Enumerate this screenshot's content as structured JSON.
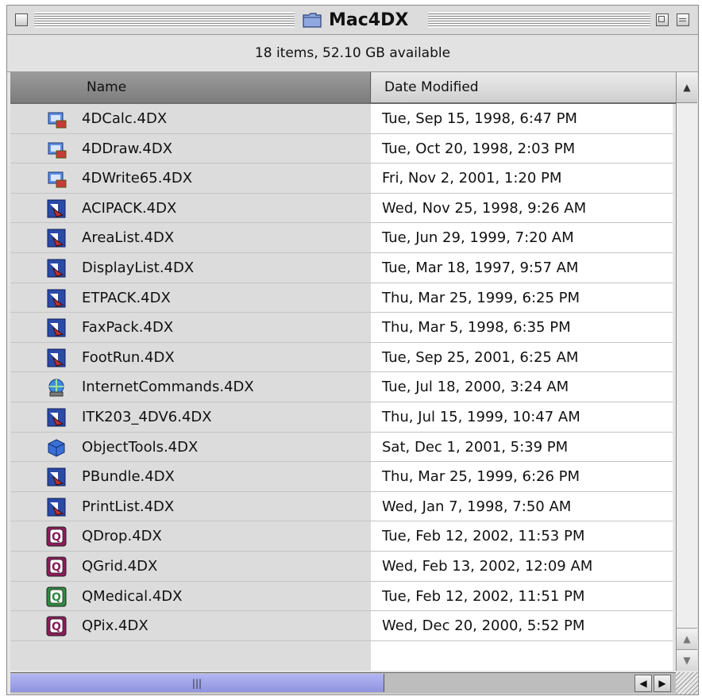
{
  "window": {
    "title": "Mac4DX",
    "status": "18 items, 52.10 GB available"
  },
  "columns": {
    "name": "Name",
    "date": "Date Modified"
  },
  "icons": {
    "folder": "folder-icon",
    "plugin": "plugin-icon",
    "q_purple": "q-icon",
    "q_green": "q-icon"
  },
  "colors": {
    "q_purple": "#8b1c5a",
    "q_green": "#2e8b3f",
    "hscroll_thumb": "#9a9ee6"
  },
  "files": [
    {
      "name": "4DCalc.4DX",
      "date": "Tue, Sep 15, 1998, 6:47 PM",
      "icon": "4d-calc-icon"
    },
    {
      "name": "4DDraw.4DX",
      "date": "Tue, Oct 20, 1998, 2:03 PM",
      "icon": "4d-draw-icon"
    },
    {
      "name": "4DWrite65.4DX",
      "date": "Fri, Nov 2, 2001, 1:20 PM",
      "icon": "4d-write-icon"
    },
    {
      "name": "ACIPACK.4DX",
      "date": "Wed, Nov 25, 1998, 9:26 AM",
      "icon": "plugin-icon"
    },
    {
      "name": "AreaList.4DX",
      "date": "Tue, Jun 29, 1999, 7:20 AM",
      "icon": "plugin-icon"
    },
    {
      "name": "DisplayList.4DX",
      "date": "Tue, Mar 18, 1997, 9:57 AM",
      "icon": "plugin-icon"
    },
    {
      "name": "ETPACK.4DX",
      "date": "Thu, Mar 25, 1999, 6:25 PM",
      "icon": "plugin-icon"
    },
    {
      "name": "FaxPack.4DX",
      "date": "Thu, Mar 5, 1998, 6:35 PM",
      "icon": "plugin-icon"
    },
    {
      "name": "FootRun.4DX",
      "date": "Tue, Sep 25, 2001, 6:25 AM",
      "icon": "plugin-icon"
    },
    {
      "name": "InternetCommands.4DX",
      "date": "Tue, Jul 18, 2000, 3:24 AM",
      "icon": "internet-icon"
    },
    {
      "name": "ITK203_4DV6.4DX",
      "date": "Thu, Jul 15, 1999, 10:47 AM",
      "icon": "plugin-icon"
    },
    {
      "name": "ObjectTools.4DX",
      "date": "Sat, Dec 1, 2001, 5:39 PM",
      "icon": "cube-icon"
    },
    {
      "name": "PBundle.4DX",
      "date": "Thu, Mar 25, 1999, 6:26 PM",
      "icon": "plugin-icon"
    },
    {
      "name": "PrintList.4DX",
      "date": "Wed, Jan 7, 1998, 7:50 AM",
      "icon": "plugin-icon"
    },
    {
      "name": "QDrop.4DX",
      "date": "Tue, Feb 12, 2002, 11:53 PM",
      "icon": "q-icon"
    },
    {
      "name": "QGrid.4DX",
      "date": "Wed, Feb 13, 2002, 12:09 AM",
      "icon": "q-icon"
    },
    {
      "name": "QMedical.4DX",
      "date": "Tue, Feb 12, 2002, 11:51 PM",
      "icon": "q-icon"
    },
    {
      "name": "QPix.4DX",
      "date": "Wed, Dec 20, 2000, 5:52 PM",
      "icon": "q-icon"
    }
  ]
}
